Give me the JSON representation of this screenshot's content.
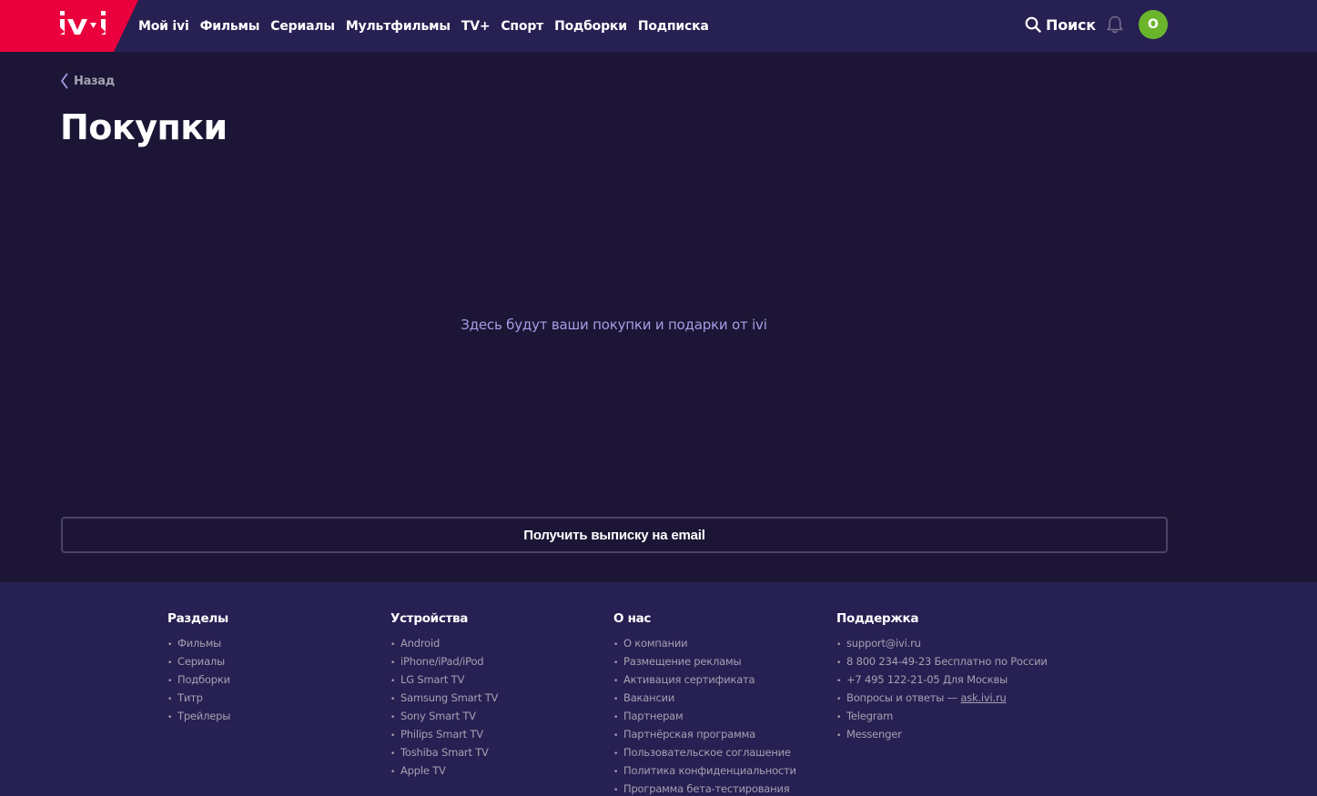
{
  "header": {
    "logo_text": "ivi",
    "nav": [
      "Мой ivi",
      "Фильмы",
      "Сериалы",
      "Мультфильмы",
      "TV+",
      "Спорт",
      "Подборки",
      "Подписка"
    ],
    "search_label": "Поиск",
    "avatar_initial": "О",
    "brand_color": "#ea003d",
    "avatar_color": "#6bb52d"
  },
  "main": {
    "back_label": "Назад",
    "title": "Покупки",
    "empty_message": "Здесь будут ваши покупки и подарки от ivi",
    "email_button": "Получить выписку на email"
  },
  "footer": {
    "sections": {
      "title": "Разделы",
      "items": [
        "Фильмы",
        "Сериалы",
        "Подборки",
        "Титр",
        "Трейлеры"
      ]
    },
    "devices": {
      "title": "Устройства",
      "items": [
        "Android",
        "iPhone/iPad/iPod",
        "LG Smart TV",
        "Samsung Smart TV",
        "Sony Smart TV",
        "Philips Smart TV",
        "Toshiba Smart TV",
        "Apple TV"
      ]
    },
    "about": {
      "title": "О нас",
      "items": [
        "О компании",
        "Размещение рекламы",
        "Активация сертификата",
        "Вакансии",
        "Партнерам",
        "Партнёрская программа",
        "Пользовательское соглашение",
        "Политика конфиденциальности",
        "Программа бета-тестирования"
      ]
    },
    "support": {
      "title": "Поддержка",
      "items": [
        "support@ivi.ru",
        "8 800 234-49-23 Бесплатно по России",
        "+7 495 122-21-05 Для Москвы"
      ],
      "faq_prefix": "Вопросы и ответы — ",
      "faq_link": "ask.ivi.ru",
      "items2": [
        "Telegram",
        "Messenger"
      ]
    }
  }
}
